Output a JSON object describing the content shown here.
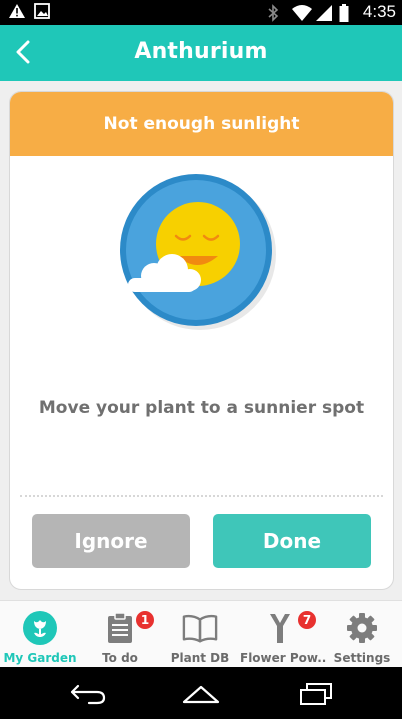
{
  "status_bar": {
    "time": "4:35",
    "icons": [
      "warning-icon",
      "image-icon",
      "bluetooth-icon",
      "wifi-icon",
      "signal-icon",
      "battery-icon"
    ]
  },
  "app_bar": {
    "title": "Anthurium",
    "back_icon": "chevron-left-icon"
  },
  "card": {
    "header": "Not enough sunlight",
    "illustration": "sun-with-cloud-icon",
    "message": "Move your plant to a sunnier spot",
    "ignore_label": "Ignore",
    "done_label": "Done"
  },
  "bottom_nav": {
    "items": [
      {
        "label": "My Garden",
        "icon": "flower-icon",
        "active": true
      },
      {
        "label": "To do",
        "icon": "clipboard-icon",
        "badge": "1"
      },
      {
        "label": "Plant DB",
        "icon": "book-icon"
      },
      {
        "label": "Flower Pow..",
        "icon": "flower-power-sensor-icon",
        "badge": "7"
      },
      {
        "label": "Settings",
        "icon": "gear-icon"
      }
    ]
  },
  "colors": {
    "teal": "#1fc7b8",
    "orange": "#f7ad45",
    "button_gray": "#b5b5b5",
    "button_teal": "#3fc6b9",
    "badge_red": "#e8312f"
  }
}
